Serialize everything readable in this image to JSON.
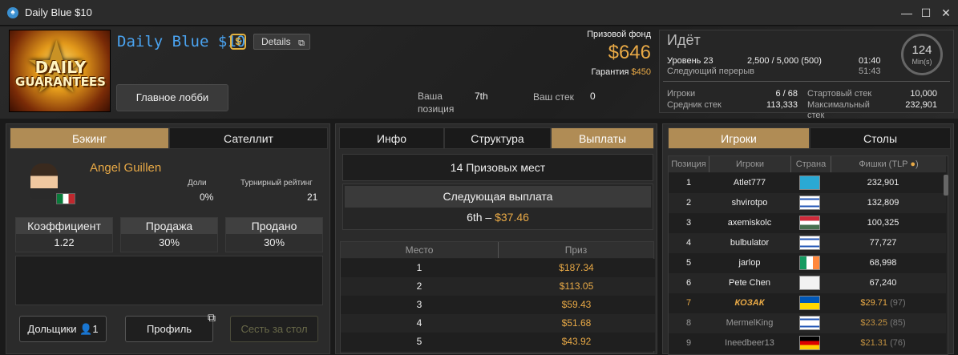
{
  "window": {
    "title": "Daily Blue $10",
    "logo_icon": "poker-logo-icon"
  },
  "header": {
    "banner_line1": "DAILY",
    "banner_line2": "GUARANTEES",
    "tournament_name": "Daily Blue $10",
    "currency_badge": "$",
    "details_label": "Details",
    "lobby_button": "Главное лобби",
    "your_position_label": "Ваша позиция",
    "your_position_value": "7th",
    "your_stack_label": "Ваш стек",
    "your_stack_value": "0",
    "prize_pool_label": "Призовой фонд",
    "prize_pool_value": "$646",
    "guarantee_label": "Гарантия",
    "guarantee_value": "$450"
  },
  "status": {
    "state": "Идёт",
    "level_label": "Уровень 23",
    "blinds": "2,500 / 5,000 (500)",
    "level_time": "01:40",
    "next_break_label": "Следующий перерыв",
    "next_break_time": "51:43",
    "clock_value": "124",
    "clock_unit": "Min(s)",
    "players_label": "Игроки",
    "players_value": "6 / 68",
    "avg_stack_label": "Средник стек",
    "avg_stack_value": "113,333",
    "start_stack_label": "Стартовый стек",
    "start_stack_value": "10,000",
    "max_stack_label": "Максимальный стек",
    "max_stack_value": "232,901"
  },
  "left": {
    "tabs": [
      "Бэкинг",
      "Сателлит"
    ],
    "player_name": "Angel Guillen",
    "shares_label": "Доли",
    "shares_value": "0%",
    "rating_label": "Турнирный рейтинг",
    "rating_value": "21",
    "coef_label": "Коэффициент",
    "coef_value": "1.22",
    "sale_label": "Продажа",
    "sale_value": "30%",
    "sold_label": "Продано",
    "sold_value": "30%",
    "shareholders_btn": "Дольщики",
    "shareholders_count": "1",
    "profile_btn": "Профиль",
    "sit_btn": "Сесть за стол"
  },
  "middle": {
    "tabs": [
      "Инфо",
      "Структура",
      "Выплаты"
    ],
    "paid_places": "14 Призовых мест",
    "next_payout_label": "Следующая выплата",
    "next_payout_place": "6th –",
    "next_payout_amount": "$37.46",
    "col_place": "Место",
    "col_prize": "Приз",
    "rows": [
      {
        "place": "1",
        "prize": "$187.34"
      },
      {
        "place": "2",
        "prize": "$113.05"
      },
      {
        "place": "3",
        "prize": "$59.43"
      },
      {
        "place": "4",
        "prize": "$51.68"
      },
      {
        "place": "5",
        "prize": "$43.92"
      }
    ]
  },
  "right": {
    "tabs": [
      "Игроки",
      "Столы"
    ],
    "col_pos": "Позиция",
    "col_player": "Игроки",
    "col_country": "Страна",
    "col_chips": "Фишки (TLP",
    "players": [
      {
        "pos": "1",
        "name": "Atlet777",
        "chips": "232,901",
        "flag": "kazakhstan",
        "sub": ""
      },
      {
        "pos": "2",
        "name": "shvirotpo",
        "chips": "132,809",
        "flag": "israel",
        "sub": ""
      },
      {
        "pos": "3",
        "name": "axemiskolc",
        "chips": "100,325",
        "flag": "hungary",
        "sub": ""
      },
      {
        "pos": "4",
        "name": "bulbulator",
        "chips": "77,727",
        "flag": "israel",
        "sub": ""
      },
      {
        "pos": "5",
        "name": "jarlop",
        "chips": "68,998",
        "flag": "ireland",
        "sub": ""
      },
      {
        "pos": "6",
        "name": "Pete Chen",
        "chips": "67,240",
        "flag": "taiwan",
        "sub": ""
      },
      {
        "pos": "7",
        "name": "КОЗАК",
        "chips": "$29.71",
        "flag": "ukraine",
        "sub": "(97)"
      },
      {
        "pos": "8",
        "name": "MermelKing",
        "chips": "$23.25",
        "flag": "israel",
        "sub": "(85)"
      },
      {
        "pos": "9",
        "name": "Ineedbeer13",
        "chips": "$21.31",
        "flag": "germany",
        "sub": "(76)"
      }
    ]
  },
  "colors": {
    "accent": "#b08c55",
    "gold": "#e8a946",
    "link": "#4aa3f0"
  }
}
